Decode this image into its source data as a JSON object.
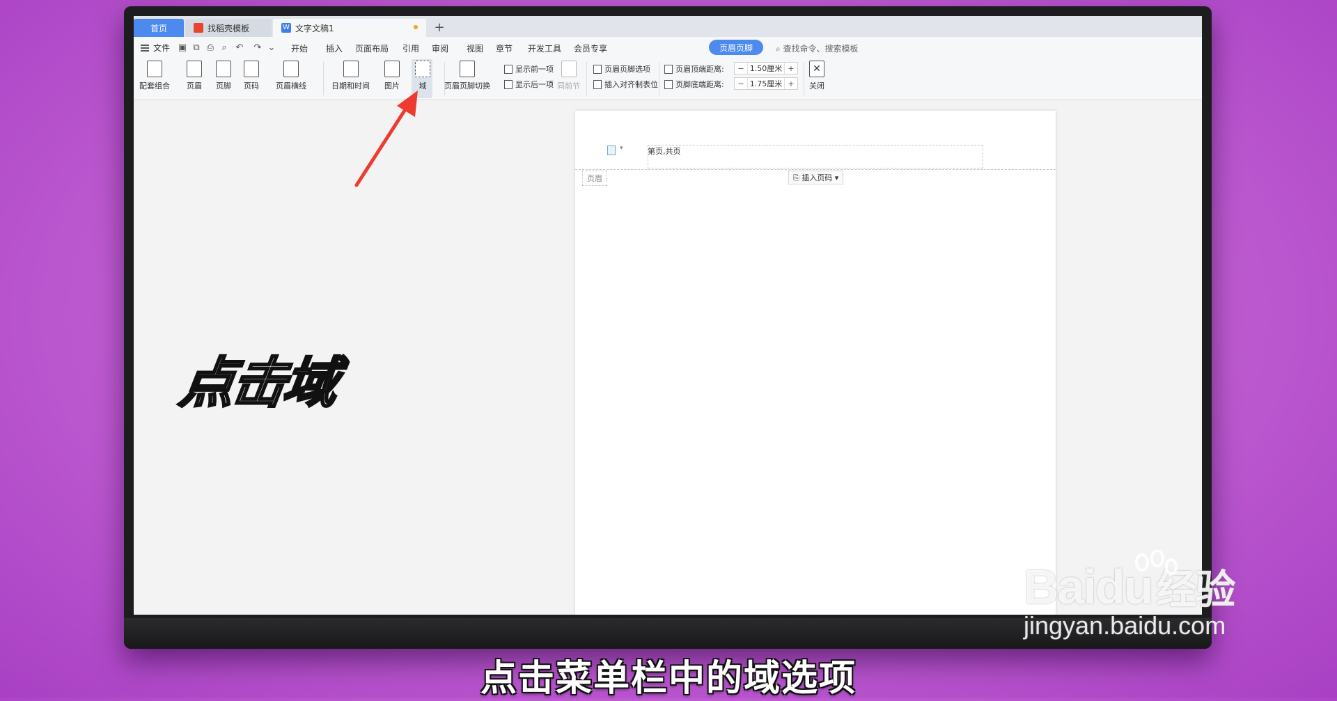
{
  "tabs": {
    "home": "首页",
    "template": "找稻壳模板",
    "document": "文字文稿1",
    "new_tab": "+"
  },
  "menu": {
    "file": "文件",
    "items": [
      "开始",
      "插入",
      "页面布局",
      "引用",
      "审阅",
      "视图",
      "章节",
      "开发工具",
      "会员专享"
    ],
    "active": "页眉页脚",
    "search_placeholder": "查找命令、搜索模板"
  },
  "ribbon": {
    "combo": "配套组合",
    "header": "页眉",
    "footer": "页脚",
    "page_number": "页码",
    "header_line": "页眉横线",
    "date_time": "日期和时间",
    "picture": "图片",
    "field": "域",
    "switch": "页眉页脚切换",
    "show_prev": "显示前一项",
    "show_next": "显示后一项",
    "same_as_prev": "同前节",
    "options": "页眉页脚选项",
    "insert_tab": "插入对齐制表位",
    "header_top_label": "页眉顶端距离:",
    "header_top_value": "1.50厘米",
    "footer_bottom_label": "页脚底端距离:",
    "footer_bottom_value": "1.75厘米",
    "close": "关闭"
  },
  "document": {
    "header_text": "第页,共页",
    "header_label": "页眉",
    "insert_page_number": "插入页码"
  },
  "overlay": {
    "big_text": "点击域",
    "subtitle": "点击菜单栏中的域选项"
  },
  "watermark": {
    "logo": "Baidu",
    "logo_cn": "经验",
    "url": "jingyan.baidu.com"
  },
  "colors": {
    "accent": "#4c8af0",
    "arrow": "#ee3b2f"
  }
}
